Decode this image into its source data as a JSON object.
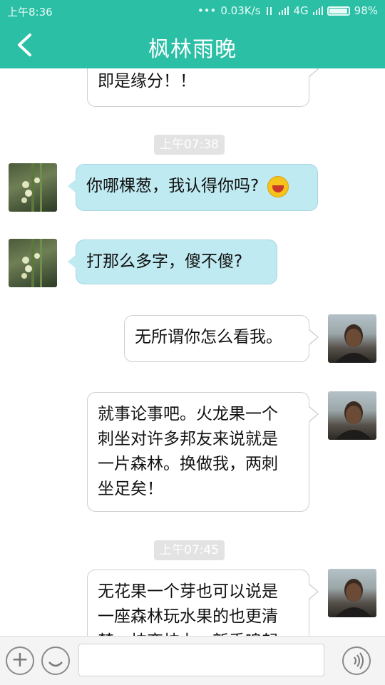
{
  "status_bar": {
    "time": "上午8:36",
    "dots": "•••",
    "speed": "0.03K/s",
    "network": "4G",
    "battery": "98%",
    "battery_level": 0.98
  },
  "header": {
    "title": "枫林雨晚",
    "back_icon": "chevron-left-icon"
  },
  "messages": [
    {
      "side": "out",
      "text": "即是缘分！！"
    },
    {
      "type": "timestamp",
      "text": "上午07:38"
    },
    {
      "side": "in",
      "text": "你哪棵葱，我认得你吗?",
      "emoji": "laughing-face-icon"
    },
    {
      "side": "in",
      "text": "打那么多字，傻不傻?"
    },
    {
      "side": "out",
      "text": "无所谓你怎么看我。"
    },
    {
      "side": "out",
      "lines": [
        "就事论事吧。火龙果一个",
        "刺坐对许多邦友来说就是",
        "一片森林。换做我，两刺",
        "坐足矣！"
      ]
    },
    {
      "type": "timestamp",
      "text": "上午07:45"
    },
    {
      "side": "out",
      "lines": [
        "无花果一个芽也可以说是",
        "一座森林玩水果的也更清",
        "楚一枝变枝力，新手嗅起"
      ]
    }
  ],
  "input_bar": {
    "placeholder": "",
    "plus_icon": "plus-icon",
    "emoji_icon": "smiley-icon",
    "voice_icon": "voice-icon"
  },
  "colors": {
    "brand": "#2bbfa6",
    "incoming_bubble": "#bfeaf1",
    "outgoing_bubble": "#ffffff",
    "timestamp_bg": "#e3e3e3"
  }
}
